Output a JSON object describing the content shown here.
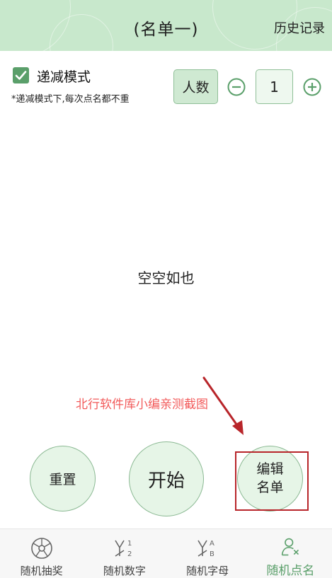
{
  "header": {
    "title": "(名单一)",
    "history_link": "历史记录"
  },
  "mode": {
    "checked": true,
    "label": "递减模式",
    "hint": "*递减模式下,每次点名都不重"
  },
  "count": {
    "button_label": "人数",
    "value": "1"
  },
  "main": {
    "empty_text": "空空如也"
  },
  "watermark": "北行软件库小编亲测截图",
  "actions": {
    "reset_label": "重置",
    "start_label": "开始",
    "edit_label_line1": "编辑",
    "edit_label_line2": "名单"
  },
  "nav": {
    "items": [
      {
        "label": "随机抽奖",
        "icon": "wheel-icon"
      },
      {
        "label": "随机数字",
        "icon": "numbers-icon"
      },
      {
        "label": "随机字母",
        "icon": "letters-icon"
      },
      {
        "label": "随机点名",
        "icon": "person-icon",
        "active": true
      }
    ]
  },
  "colors": {
    "accent": "#5a9f6a",
    "header_bg": "#c8e8cc",
    "button_bg": "#e6f5e7",
    "annotation": "#f25a5a"
  }
}
